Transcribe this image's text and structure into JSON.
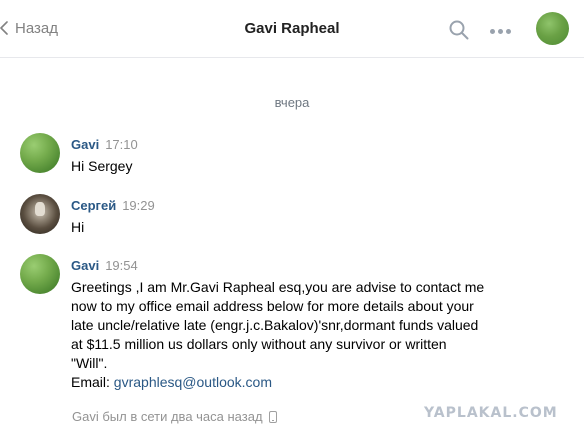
{
  "header": {
    "back_label": "Назад",
    "title": "Gavi Rapheal"
  },
  "date_separator": "вчера",
  "messages": [
    {
      "author": "Gavi",
      "time": "17:10",
      "text": "Hi Sergey"
    },
    {
      "author": "Сергей",
      "time": "19:29",
      "text": "Hi"
    },
    {
      "author": "Gavi",
      "time": "19:54",
      "lines": [
        "Greetings ,I am Mr.Gavi Rapheal esq,you are advise to contact me",
        "now to my office email address below for more details about your",
        "late uncle/relative late (engr.j.c.Bakalov)'snr,dormant funds valued",
        "at $11.5 million us dollars only without any survivor or written",
        "\"Will\"."
      ],
      "email_label": "Email: ",
      "email": "gvraphlesq@outlook.com"
    }
  ],
  "status": "Gavi был в сети два часа назад",
  "watermark": "YAPLAKAL.COM",
  "colors": {
    "link": "#2a5885",
    "muted": "#939393",
    "divider": "#e7e8ec"
  },
  "icons": {
    "back": "chevron-left-icon",
    "search": "search-icon",
    "more": "more-dots-icon",
    "phone": "mobile-phone-icon"
  }
}
